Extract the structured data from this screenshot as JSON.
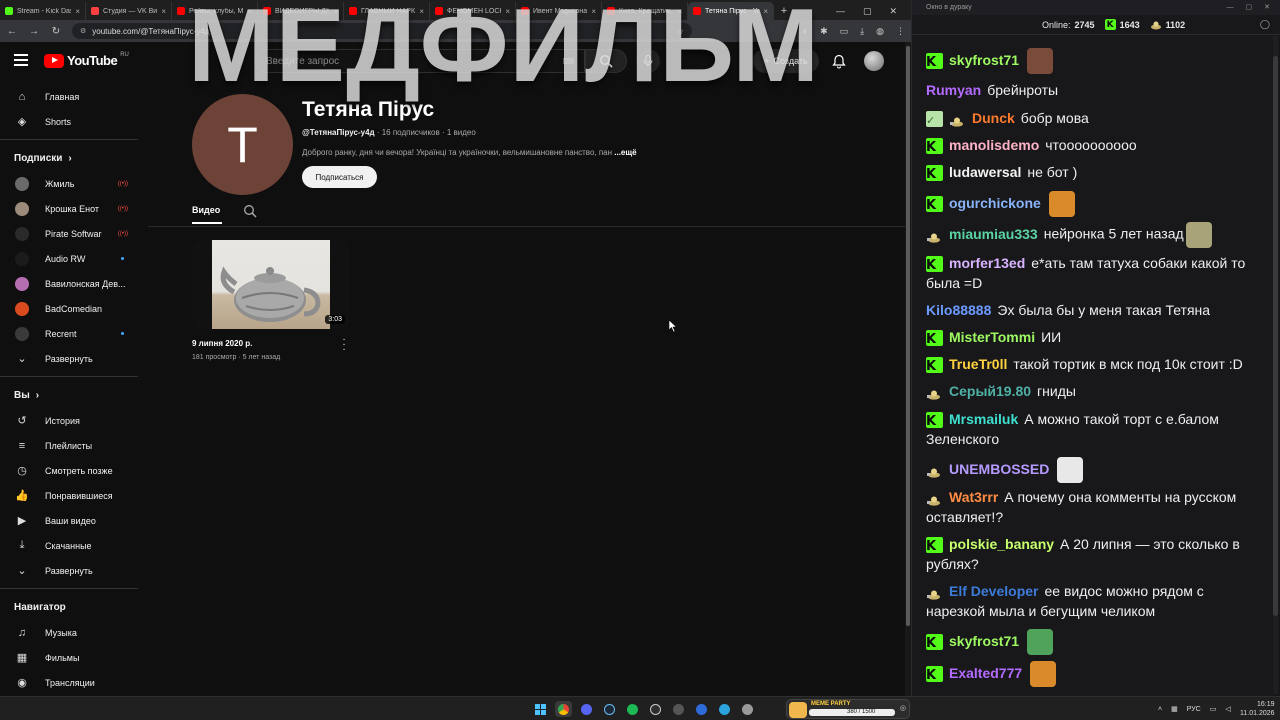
{
  "browser": {
    "tabs": [
      {
        "title": "Stream - Kick Dash",
        "color": "#53fc18"
      },
      {
        "title": "Студия — VK Видео",
        "color": "#ff4040"
      },
      {
        "title": "Рейвы, клубы, Ма",
        "color": "#ff0000"
      },
      {
        "title": "ВИДЕОИГРЫ ДЖ",
        "color": "#ff0000"
      },
      {
        "title": "ГЛАВНЫЙ НАРКО",
        "color": "#ff0000"
      },
      {
        "title": "ФЕНОМЕН LOCKE",
        "color": "#ff0000"
      },
      {
        "title": "Ивент Мэдисона",
        "color": "#ff0000"
      },
      {
        "title": "Киев, Крещатик, ч",
        "color": "#ff0000"
      },
      {
        "title": "Тетяна Пірус - You",
        "color": "#ff0000",
        "active": true
      }
    ],
    "new_tab": "+",
    "url": "youtube.com/@ТетянаПірус-у4д"
  },
  "youtube": {
    "logo_text": "YouTube",
    "region": "RU",
    "search_placeholder": "Введите запрос",
    "create_label": "Создать",
    "overlay_title": "МЕДФИЛЬМ"
  },
  "sidebar": {
    "main": [
      {
        "label": "Главная",
        "icon": "home-icon",
        "glyph": "⌂"
      },
      {
        "label": "Shorts",
        "icon": "shorts-icon",
        "glyph": "◈"
      }
    ],
    "subs_title": "Подписки",
    "subs": [
      {
        "label": "Жмиль",
        "color": "#6b6b6b",
        "status": "live"
      },
      {
        "label": "Крошка Енот Play",
        "color": "#9c8a7a",
        "status": "live"
      },
      {
        "label": "Pirate Software",
        "color": "#2a2a2a",
        "status": "live"
      },
      {
        "label": "Audio RW",
        "color": "#1b1b1b",
        "status": "dot"
      },
      {
        "label": "Вавилонская Дев...",
        "color": "#b56fb0",
        "status": "none"
      },
      {
        "label": "BadComedian",
        "color": "#d94a1e",
        "status": "none"
      },
      {
        "label": "Recrent",
        "color": "#3a3a3a",
        "status": "dot"
      }
    ],
    "expand_label": "Развернуть",
    "you_title": "Вы",
    "you": [
      {
        "label": "История",
        "icon": "history-icon",
        "glyph": "↺"
      },
      {
        "label": "Плейлисты",
        "icon": "playlists-icon",
        "glyph": "≡"
      },
      {
        "label": "Смотреть позже",
        "icon": "watch-later-icon",
        "glyph": "◷"
      },
      {
        "label": "Понравившиеся",
        "icon": "like-icon",
        "glyph": "👍"
      },
      {
        "label": "Ваши видео",
        "icon": "your-videos-icon",
        "glyph": "▶"
      },
      {
        "label": "Скачанные",
        "icon": "downloads-icon",
        "glyph": "⤓"
      }
    ],
    "expand_label_2": "Развернуть",
    "nav_title": "Навигатор",
    "nav": [
      {
        "label": "Музыка",
        "icon": "music-icon",
        "glyph": "♫"
      },
      {
        "label": "Фильмы",
        "icon": "films-icon",
        "glyph": "▦"
      },
      {
        "label": "Трансляции",
        "icon": "live-icon",
        "glyph": "◉"
      }
    ]
  },
  "channel": {
    "avatar_letter": "Т",
    "name": "Тетяна Пірус",
    "handle": "@ТетянаПірус-у4д",
    "subscribers": "16 подписчиков",
    "videos": "1 видео",
    "description": "Доброго ранку, дня чи вечора! Українці та україночки, вельмишановне панство, пан",
    "more": "...ещё",
    "subscribe_label": "Подписаться",
    "tab_videos": "Видео"
  },
  "video": {
    "title": "9 липня 2020 р.",
    "views": "181 просмотр",
    "age": "5 лет назад",
    "duration": "3:03"
  },
  "chat": {
    "window_title": "Окно в дураку",
    "online_label": "Online:",
    "online_count": "2745",
    "kick_count": "1643",
    "tt_count": "1102",
    "messages": [
      {
        "badge": "kick",
        "user": "skyfrost71",
        "color": "#9efa61",
        "text": "",
        "emote": "#7a4a3a"
      },
      {
        "badge": "none",
        "user": "Rumyan",
        "color": "#b46bff",
        "text": "брейнроты"
      },
      {
        "badge": "tt",
        "user": "Dunck",
        "color": "#ff7a2d",
        "text": "бобр мова",
        "extra": "check"
      },
      {
        "badge": "kick",
        "user": "manolisdemo",
        "color": "#ffb3c6",
        "text": "чтоооооооооо"
      },
      {
        "badge": "kick",
        "user": "ludawersal",
        "color": "#f3f3f3",
        "text": "не бот )"
      },
      {
        "badge": "kick",
        "user": "ogurchickone",
        "color": "#8ab4f8",
        "text": "",
        "emote": "#d98a2a"
      },
      {
        "badge": "tt",
        "user": "miaumiau333",
        "color": "#5ad4a4",
        "text": "нейронка 5 лет назад",
        "emote": "#a9a37a"
      },
      {
        "badge": "kick",
        "user": "morfer13ed",
        "color": "#d9b3ff",
        "text": "е*ать там татуха собаки какой то была =D"
      },
      {
        "badge": "none",
        "user": "Kilo88888",
        "color": "#6b9bff",
        "text": "Эх была бы у меня такая Тетяна"
      },
      {
        "badge": "kick",
        "user": "MisterTommi",
        "color": "#9efa61",
        "text": "ИИ"
      },
      {
        "badge": "kick",
        "user": "TrueTr0ll",
        "color": "#ffd23f",
        "text": "такой тортик в мск под 10к стоит :D"
      },
      {
        "badge": "tt",
        "user": "Серый19.80",
        "color": "#4fb0a6",
        "text": "гниды"
      },
      {
        "badge": "kick",
        "user": "Mrsmailuk",
        "color": "#3fe0d0",
        "text": "А можно такой торт с е.балом Зеленского"
      },
      {
        "badge": "tt",
        "user": "UNEMBOSSED",
        "color": "#b59bff",
        "text": "",
        "emote": "#e8e8e8"
      },
      {
        "badge": "tt",
        "user": "Wat3rrr",
        "color": "#ff8c42",
        "text": "А почему она комменты на русском оставляет!?"
      },
      {
        "badge": "kick",
        "user": "polskie_banany",
        "color": "#c6ff6b",
        "text": "А 20 липня — это сколько в рублях?"
      },
      {
        "badge": "tt",
        "user": "Elf Developer",
        "color": "#3d7bd9",
        "text": "ее видос можно рядом с нарезкой мыла и бегущим челиком"
      },
      {
        "badge": "kick",
        "user": "skyfrost71",
        "color": "#9efa61",
        "text": "",
        "emote": "#4fa35a"
      },
      {
        "badge": "kick",
        "user": "Exalted777",
        "color": "#b46bff",
        "text": "",
        "emote": "#d98a2a"
      }
    ]
  },
  "taskbar": {
    "meme_label": "MEME PARTY",
    "meme_value": "380 / 1500",
    "lang": "РУС",
    "time": "16:19",
    "date": "11.01.2026"
  }
}
